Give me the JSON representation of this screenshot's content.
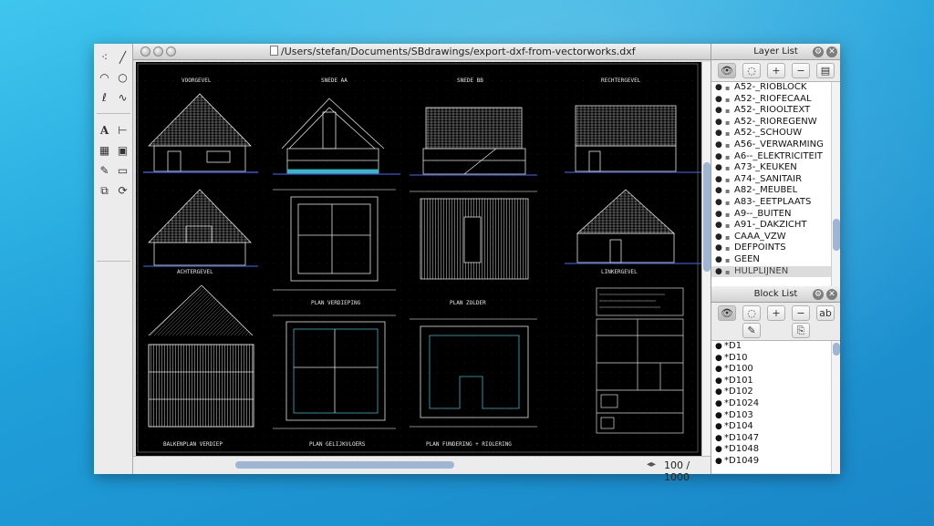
{
  "window": {
    "title": "/Users/stefan/Documents/SBdrawings/export-dxf-from-vectorworks.dxf"
  },
  "toolbox": {
    "tools": [
      {
        "icon": "selection-points-icon"
      },
      {
        "icon": "line-tool-icon"
      },
      {
        "icon": "arc-tool-icon"
      },
      {
        "icon": "circle-tool-icon"
      },
      {
        "icon": "freehand-tool-icon"
      },
      {
        "icon": "spline-tool-icon"
      },
      {
        "icon": "text-tool-icon",
        "glyph": "A"
      },
      {
        "icon": "dimension-tool-icon"
      },
      {
        "icon": "hatch-tool-icon"
      },
      {
        "icon": "image-tool-icon"
      },
      {
        "icon": "edit-tool-icon"
      },
      {
        "icon": "trim-tool-icon"
      },
      {
        "icon": "block-tool-icon"
      },
      {
        "icon": "offset-tool-icon"
      }
    ]
  },
  "drawing": {
    "labels": [
      "VOORGEVEL",
      "SNEDE AA",
      "SNEDE BB",
      "RECHTERGEVEL",
      "ACHTERGEVEL",
      "PLAN VERDIEPING",
      "PLAN ZOLDER",
      "LINKERGEVEL",
      "BALKENPLAN VERDIEP",
      "PLAN GELIJKVLOERS",
      "PLAN FUNDERING + RIOLERING"
    ]
  },
  "status": {
    "zoom": "100 / 1000"
  },
  "layer_panel": {
    "title": "Layer List",
    "layers": [
      {
        "name": "A52-_RIOBLOCK",
        "locked": true
      },
      {
        "name": "A52-_RIOFECAAL",
        "locked": true
      },
      {
        "name": "A52-_RIOOLTEXT",
        "locked": true
      },
      {
        "name": "A52-_RIOREGENW",
        "locked": true
      },
      {
        "name": "A52-_SCHOUW",
        "locked": true
      },
      {
        "name": "A56-_VERWARMING",
        "locked": true
      },
      {
        "name": "A6--_ELEKTRICITEIT",
        "locked": true
      },
      {
        "name": "A73-_KEUKEN",
        "locked": true
      },
      {
        "name": "A74-_SANITAIR",
        "locked": true
      },
      {
        "name": "A82-_MEUBEL",
        "locked": true
      },
      {
        "name": "A83-_EETPLAATS",
        "locked": true
      },
      {
        "name": "A9--_BUITEN",
        "locked": true
      },
      {
        "name": "A91-_DAKZICHT",
        "locked": true
      },
      {
        "name": "CAAA_VZW",
        "locked": true
      },
      {
        "name": "DEFPOINTS",
        "locked": true
      },
      {
        "name": "GEEN",
        "locked": true
      },
      {
        "name": "HULPLIJNEN",
        "locked": true
      }
    ]
  },
  "block_panel": {
    "title": "Block List",
    "blocks": [
      "*D1",
      "*D10",
      "*D100",
      "*D101",
      "*D102",
      "*D1024",
      "*D103",
      "*D104",
      "*D1047",
      "*D1048",
      "*D1049"
    ]
  }
}
